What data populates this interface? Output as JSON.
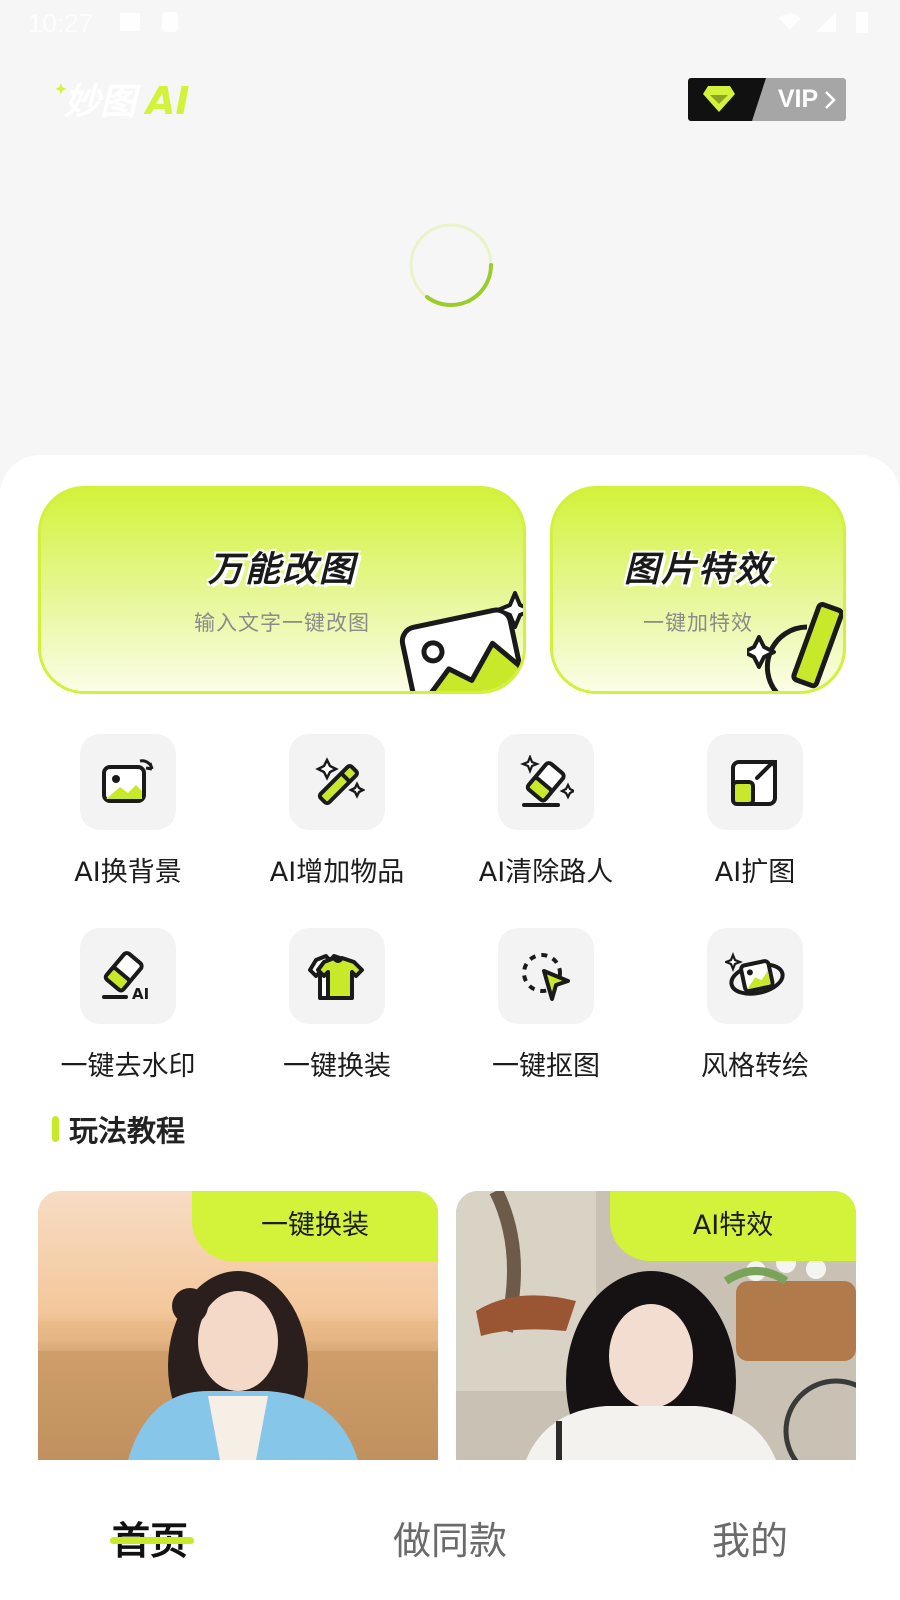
{
  "status_bar": {
    "time": "10:27"
  },
  "header": {
    "logo_text": "妙图AI",
    "vip_label": "VIP"
  },
  "feature_cards": [
    {
      "title": "万能改图",
      "subtitle": "输入文字一键改图"
    },
    {
      "title": "图片特效",
      "subtitle": "一键加特效"
    }
  ],
  "tools": [
    {
      "label": "AI换背景",
      "icon": "image-swap-icon"
    },
    {
      "label": "AI增加物品",
      "icon": "magic-wand-icon"
    },
    {
      "label": "AI清除路人",
      "icon": "eraser-icon"
    },
    {
      "label": "AI扩图",
      "icon": "expand-image-icon"
    },
    {
      "label": "一键去水印",
      "icon": "watermark-eraser-icon"
    },
    {
      "label": "一键换装",
      "icon": "tshirt-icon"
    },
    {
      "label": "一键抠图",
      "icon": "cutout-cursor-icon"
    },
    {
      "label": "风格转绘",
      "icon": "style-transfer-icon"
    }
  ],
  "tutorials": {
    "section_title": "玩法教程",
    "items": [
      {
        "tag": "一键换装"
      },
      {
        "tag": "AI特效"
      }
    ]
  },
  "bottom_nav": [
    {
      "label": "首页",
      "active": true
    },
    {
      "label": "做同款",
      "active": false
    },
    {
      "label": "我的",
      "active": false
    }
  ],
  "colors": {
    "accent": "#d3f23a",
    "accent_dark": "#c8e82a",
    "text": "#1c1c1c"
  }
}
